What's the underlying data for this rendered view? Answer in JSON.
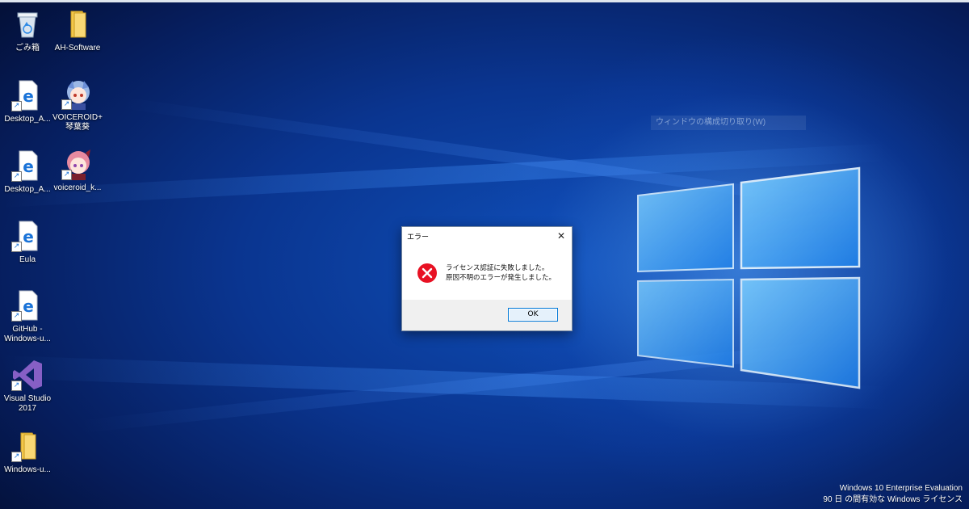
{
  "desktop": {
    "icons": [
      {
        "label": "ごみ箱",
        "icon": "recycle-bin-icon"
      },
      {
        "label": "AH-Software",
        "icon": "folder-icon"
      },
      {
        "label": "Desktop_A...",
        "icon": "edge-file-icon"
      },
      {
        "label": "VOICEROID+\n琴葉葵",
        "icon": "voiceroid-aoi-icon"
      },
      {
        "label": "Desktop_A...",
        "icon": "edge-file-icon"
      },
      {
        "label": "voiceroid_k...",
        "icon": "voiceroid-akane-icon"
      },
      {
        "label": "Eula",
        "icon": "edge-file-icon"
      },
      {
        "label": "GitHub -\nWindows-u...",
        "icon": "edge-file-icon"
      },
      {
        "label": "Visual Studio\n2017",
        "icon": "visual-studio-icon"
      },
      {
        "label": "Windows-u...",
        "icon": "folder-icon"
      }
    ],
    "context_item": "ウィンドウの構成切り取り(W)"
  },
  "dialog": {
    "title": "エラー",
    "close_glyph": "✕",
    "message_line1": "ライセンス認証に失敗しました。",
    "message_line2": "原因不明のエラーが発生しました。",
    "ok_label": "OK",
    "icon": "error-icon"
  },
  "watermark": {
    "line1": "Windows 10 Enterprise Evaluation",
    "line2": "90 日 の間有効な Windows ライセンス"
  },
  "colors": {
    "accent": "#0078d7",
    "error_red": "#e81123",
    "desktop_blue": "#0a3590"
  }
}
